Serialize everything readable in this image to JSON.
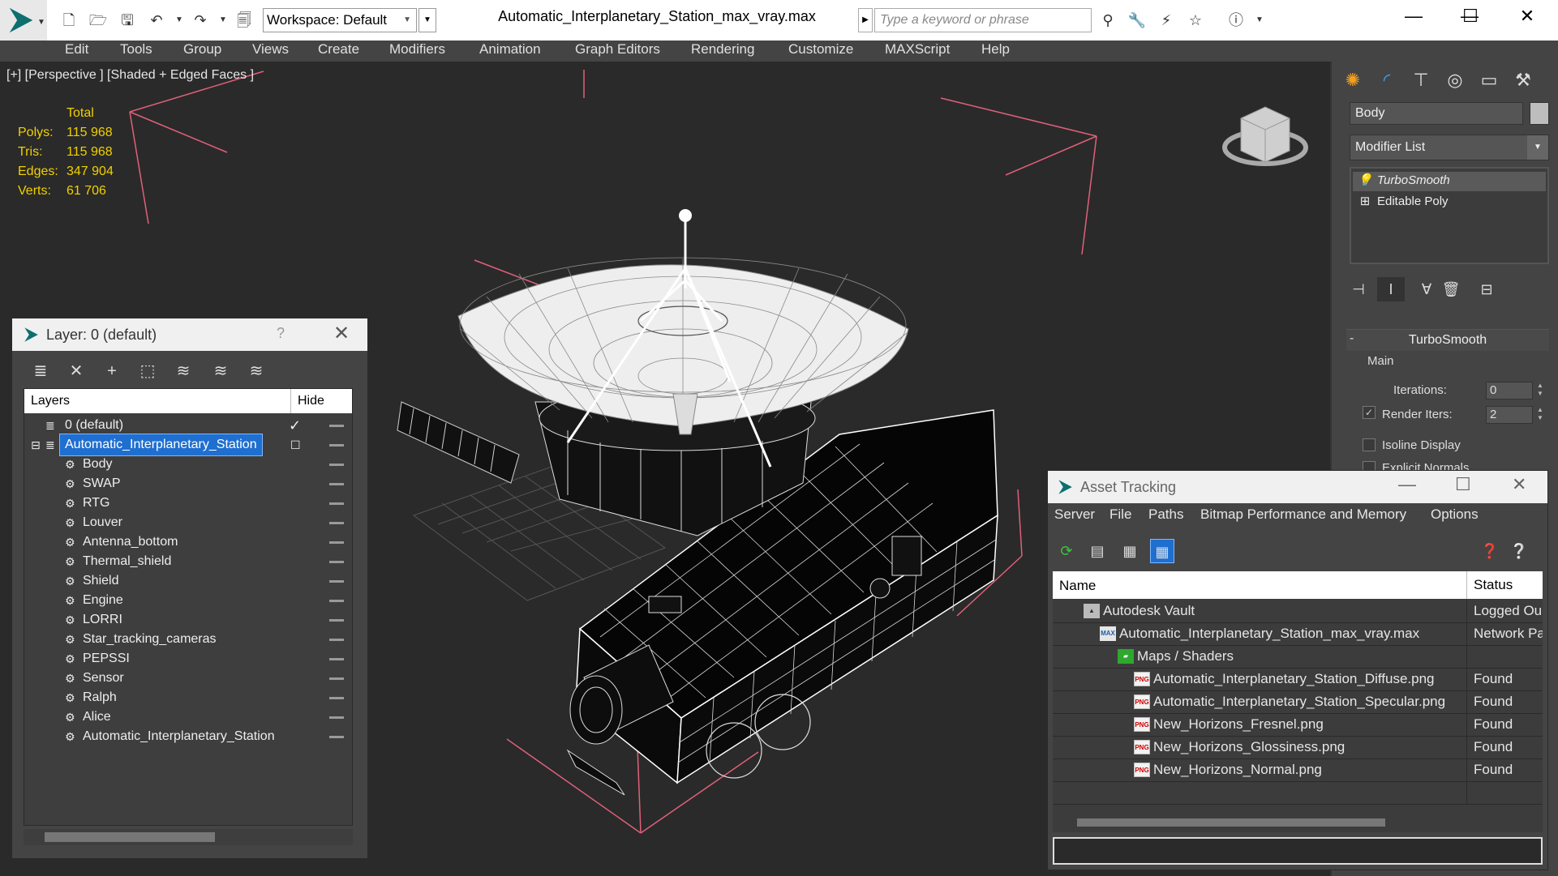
{
  "app": {
    "title": "Automatic_Interplanetary_Station_max_vray.max",
    "workspace_label": "Workspace: Default",
    "search_placeholder": "Type a keyword or phrase"
  },
  "menu": [
    "Edit",
    "Tools",
    "Group",
    "Views",
    "Create",
    "Modifiers",
    "Animation",
    "Graph Editors",
    "Rendering",
    "Customize",
    "MAXScript",
    "Help"
  ],
  "viewport": {
    "label": "[+] [Perspective ] [Shaded + Edged Faces ]",
    "stats_header": "Total",
    "stats": [
      {
        "label": "Polys:",
        "value": "115 968"
      },
      {
        "label": "Tris:",
        "value": "115 968"
      },
      {
        "label": "Edges:",
        "value": "347 904"
      },
      {
        "label": "Verts:",
        "value": "61 706"
      }
    ]
  },
  "command_panel": {
    "object_name": "Body",
    "object_color": "#bdbdbd",
    "modifier_list_label": "Modifier List",
    "stack": [
      {
        "label": "TurboSmooth",
        "active": true
      },
      {
        "label": "Editable Poly",
        "active": false
      }
    ],
    "rollout": {
      "title": "TurboSmooth",
      "group_label": "Main",
      "iterations_label": "Iterations:",
      "iterations_value": "0",
      "render_iters_label": "Render Iters:",
      "render_iters_value": "2",
      "render_iters_checked": true,
      "isoline_label": "Isoline Display",
      "explicit_normals_label": "Explicit Normals"
    }
  },
  "layer_dialog": {
    "title": "Layer: 0 (default)",
    "help": "?",
    "col_layers": "Layers",
    "col_hide": "Hide",
    "rows": [
      {
        "label": "0 (default)",
        "level": 0,
        "type": "layer"
      },
      {
        "label": "Automatic_Interplanetary_Station",
        "level": 0,
        "type": "layer",
        "selected": true
      },
      {
        "label": "Body",
        "level": 1,
        "type": "object"
      },
      {
        "label": "SWAP",
        "level": 1,
        "type": "object"
      },
      {
        "label": "RTG",
        "level": 1,
        "type": "object"
      },
      {
        "label": "Louver",
        "level": 1,
        "type": "object"
      },
      {
        "label": "Antenna_bottom",
        "level": 1,
        "type": "object"
      },
      {
        "label": "Thermal_shield",
        "level": 1,
        "type": "object"
      },
      {
        "label": "Shield",
        "level": 1,
        "type": "object"
      },
      {
        "label": "Engine",
        "level": 1,
        "type": "object"
      },
      {
        "label": "LORRI",
        "level": 1,
        "type": "object"
      },
      {
        "label": "Star_tracking_cameras",
        "level": 1,
        "type": "object"
      },
      {
        "label": "PEPSSI",
        "level": 1,
        "type": "object"
      },
      {
        "label": "Sensor",
        "level": 1,
        "type": "object"
      },
      {
        "label": "Ralph",
        "level": 1,
        "type": "object"
      },
      {
        "label": "Alice",
        "level": 1,
        "type": "object"
      },
      {
        "label": "Automatic_Interplanetary_Station",
        "level": 1,
        "type": "object"
      }
    ]
  },
  "asset_dialog": {
    "title": "Asset Tracking",
    "menu": [
      "Server",
      "File",
      "Paths",
      "Bitmap Performance and Memory",
      "Options"
    ],
    "col_name": "Name",
    "col_status": "Status",
    "rows": [
      {
        "name": "Autodesk Vault",
        "status": "Logged Ou",
        "level": 1,
        "icon": "vault"
      },
      {
        "name": "Automatic_Interplanetary_Station_max_vray.max",
        "status": "Network Pa",
        "level": 2,
        "icon": "max"
      },
      {
        "name": "Maps / Shaders",
        "status": "",
        "level": 3,
        "icon": "maps"
      },
      {
        "name": "Automatic_Interplanetary_Station_Diffuse.png",
        "status": "Found",
        "level": 4,
        "icon": "png"
      },
      {
        "name": "Automatic_Interplanetary_Station_Specular.png",
        "status": "Found",
        "level": 4,
        "icon": "png"
      },
      {
        "name": "New_Horizons_Fresnel.png",
        "status": "Found",
        "level": 4,
        "icon": "png"
      },
      {
        "name": "New_Horizons_Glossiness.png",
        "status": "Found",
        "level": 4,
        "icon": "png"
      },
      {
        "name": "New_Horizons_Normal.png",
        "status": "Found",
        "level": 4,
        "icon": "png"
      }
    ]
  }
}
